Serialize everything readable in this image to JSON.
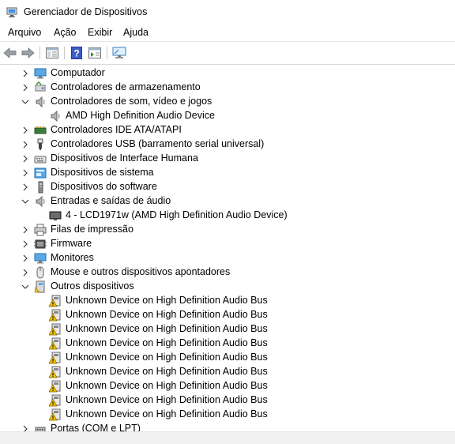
{
  "window": {
    "title": "Gerenciador de Dispositivos"
  },
  "menu": {
    "items": [
      "Arquivo",
      "Ação",
      "Exibir",
      "Ajuda"
    ]
  },
  "tree": {
    "categories": [
      {
        "label": "Computador"
      },
      {
        "label": "Controladores de armazenamento"
      },
      {
        "label": "Controladores de som, vídeo e jogos",
        "expanded": true
      },
      {
        "label": "Controladores IDE ATA/ATAPI"
      },
      {
        "label": "Controladores USB (barramento serial universal)"
      },
      {
        "label": "Dispositivos de Interface Humana"
      },
      {
        "label": "Dispositivos de sistema"
      },
      {
        "label": "Dispositivos do software"
      },
      {
        "label": "Entradas e saídas de áudio",
        "expanded": true
      },
      {
        "label": "Filas de impressão"
      },
      {
        "label": "Firmware"
      },
      {
        "label": "Monitores"
      },
      {
        "label": "Mouse e outros dispositivos apontadores"
      },
      {
        "label": "Outros dispositivos",
        "expanded": true
      },
      {
        "label": "Portas (COM e LPT)"
      }
    ],
    "children": {
      "sound": [
        "AMD High Definition Audio Device"
      ],
      "audio_io": [
        "4 - LCD1971w (AMD High Definition Audio Device)"
      ],
      "other": [
        "Unknown Device on High Definition Audio Bus",
        "Unknown Device on High Definition Audio Bus",
        "Unknown Device on High Definition Audio Bus",
        "Unknown Device on High Definition Audio Bus",
        "Unknown Device on High Definition Audio Bus",
        "Unknown Device on High Definition Audio Bus",
        "Unknown Device on High Definition Audio Bus",
        "Unknown Device on High Definition Audio Bus",
        "Unknown Device on High Definition Audio Bus"
      ]
    }
  }
}
